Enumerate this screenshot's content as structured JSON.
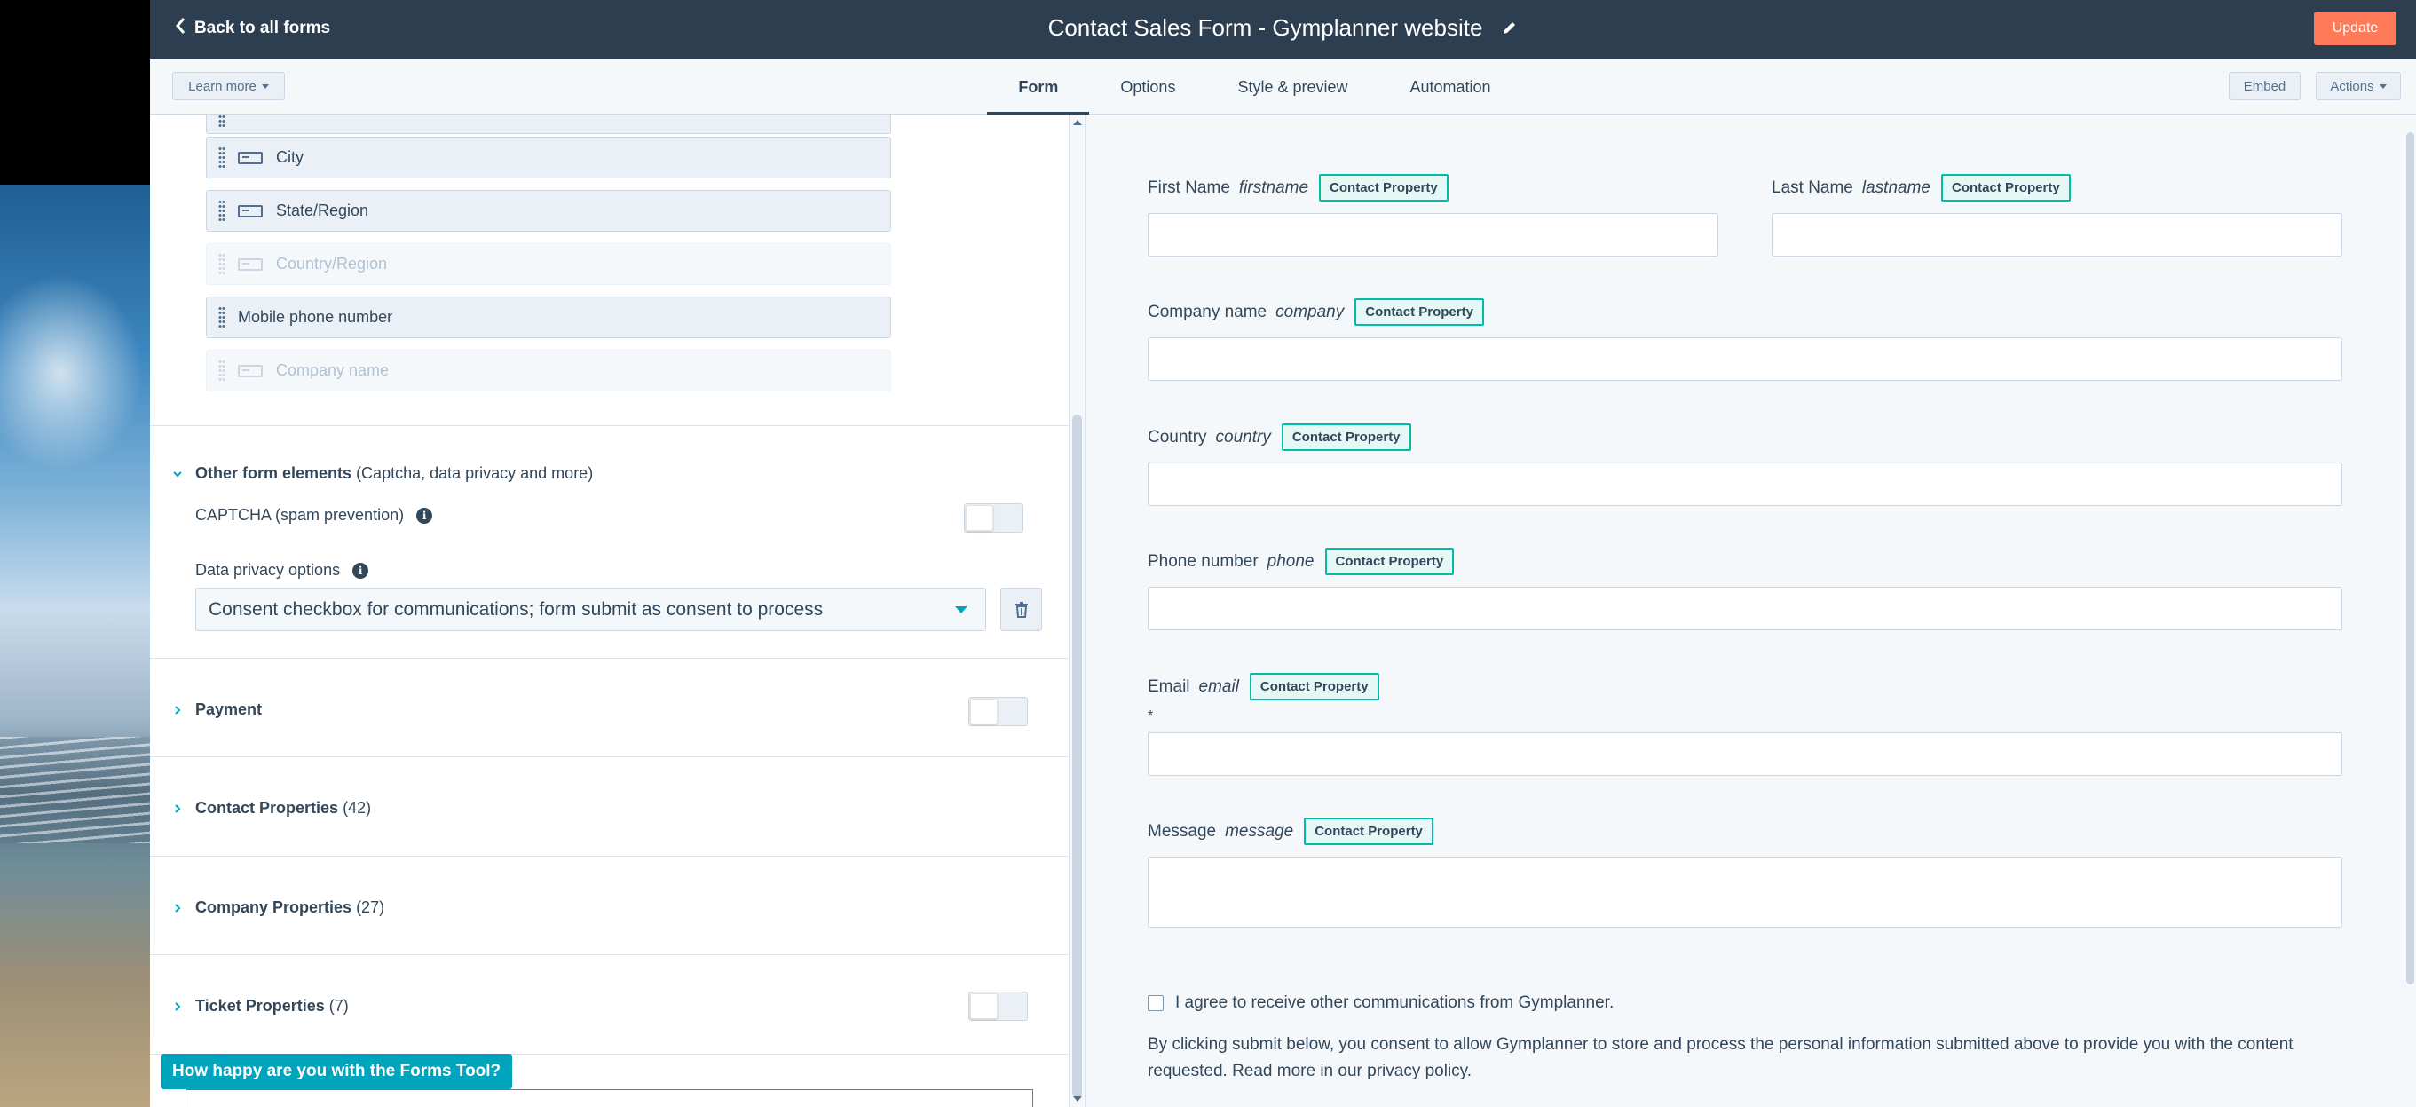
{
  "header": {
    "back_label": "Back to all forms",
    "title": "Contact Sales Form - Gymplanner website",
    "update_label": "Update"
  },
  "subnav": {
    "learn_more_label": "Learn more",
    "tabs": [
      {
        "label": "Form",
        "active": true
      },
      {
        "label": "Options",
        "active": false
      },
      {
        "label": "Style & preview",
        "active": false
      },
      {
        "label": "Automation",
        "active": false
      }
    ],
    "embed_label": "Embed",
    "actions_label": "Actions"
  },
  "left_panel": {
    "fields": [
      {
        "label": "City",
        "enabled": true,
        "icon": "text-field-icon"
      },
      {
        "label": "State/Region",
        "enabled": true,
        "icon": "text-field-icon"
      },
      {
        "label": "Country/Region",
        "enabled": false,
        "icon": "text-field-icon"
      },
      {
        "label": "Mobile phone number",
        "enabled": true,
        "icon": "phone-field-icon"
      },
      {
        "label": "Company name",
        "enabled": false,
        "icon": "text-field-icon"
      }
    ],
    "other_elements": {
      "title": "Other form elements",
      "subtitle": "(Captcha, data privacy and more)",
      "captcha_label": "CAPTCHA (spam prevention)",
      "captcha_on": false,
      "privacy_label": "Data privacy options",
      "privacy_value": "Consent checkbox for communications; form submit as consent to process"
    },
    "sections": [
      {
        "title": "Payment",
        "count": "",
        "has_toggle": true
      },
      {
        "title": "Contact Properties",
        "count": "(42)",
        "has_toggle": false
      },
      {
        "title": "Company Properties",
        "count": "(27)",
        "has_toggle": false
      },
      {
        "title": "Ticket Properties",
        "count": "(7)",
        "has_toggle": true
      }
    ],
    "feedback_label": "How happy are you with the Forms Tool?"
  },
  "preview": {
    "badge": "Contact Property",
    "fields": [
      {
        "label": "First Name",
        "prop": "firstname"
      },
      {
        "label": "Last Name",
        "prop": "lastname"
      },
      {
        "label": "Company name",
        "prop": "company"
      },
      {
        "label": "Country",
        "prop": "country"
      },
      {
        "label": "Phone number",
        "prop": "phone"
      },
      {
        "label": "Email",
        "prop": "email"
      },
      {
        "label": "Message",
        "prop": "message"
      }
    ],
    "required_mark": "*",
    "consent_label": "I agree to receive other communications from Gymplanner.",
    "legal_text": "By clicking submit below, you consent to allow Gymplanner to store and process the personal information submitted above to provide you with the content requested. Read more in our privacy policy."
  },
  "colors": {
    "topbar": "#2d3e50",
    "update_button": "#ff7a59",
    "accent": "#00a4bd",
    "badge_border": "#00bda5"
  }
}
